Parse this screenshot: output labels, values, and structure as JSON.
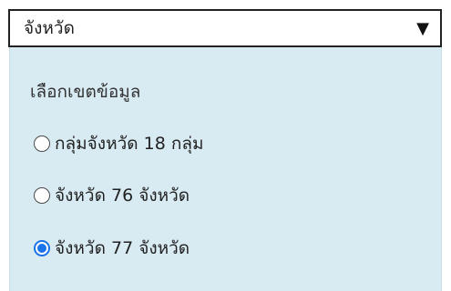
{
  "select": {
    "value": "จังหวัด",
    "arrow_glyph": "▼"
  },
  "panel": {
    "title": "เลือกเขตข้อมูล",
    "options": [
      {
        "label": "กลุ่มจังหวัด 18 กลุ่ม",
        "checked": false
      },
      {
        "label": "จังหวัด 76 จังหวัด",
        "checked": false
      },
      {
        "label": "จังหวัด 77 จังหวัด",
        "checked": true
      }
    ]
  },
  "colors": {
    "panel_background": "#d8eaf2",
    "radio_selected": "#1a73e8",
    "border": "#222222"
  }
}
